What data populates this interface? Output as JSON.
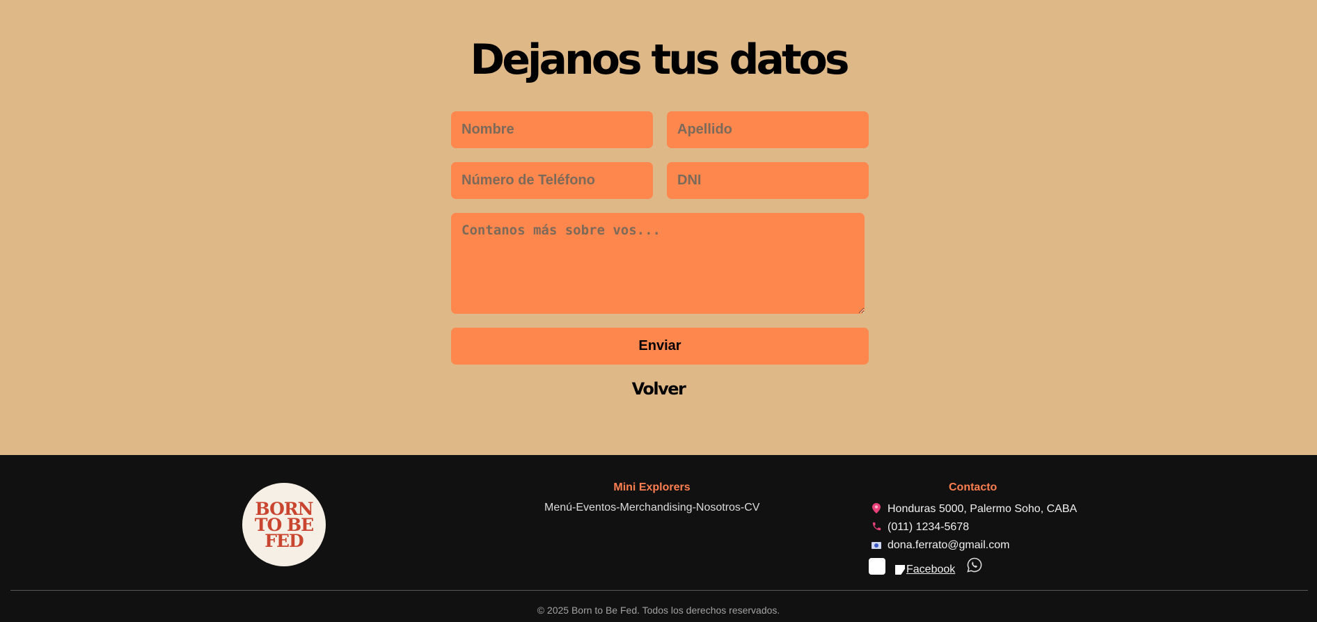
{
  "form": {
    "title": "Dejanos tus datos",
    "fields": {
      "nombre": {
        "placeholder": "Nombre",
        "value": ""
      },
      "apellido": {
        "placeholder": "Apellido",
        "value": ""
      },
      "telefono": {
        "placeholder": "Número de Teléfono",
        "value": ""
      },
      "dni": {
        "placeholder": "DNI",
        "value": ""
      },
      "mensaje": {
        "placeholder": "Contanos más sobre vos...",
        "value": ""
      }
    },
    "submit_label": "Enviar",
    "back_label": "Volver"
  },
  "footer": {
    "logo": {
      "lines": [
        "BORN",
        "TO BE",
        "FED"
      ],
      "color": "#c9452f"
    },
    "brand": {
      "title": "Mini Explorers",
      "nav": [
        "Menú",
        "Eventos",
        "Merchandising",
        "Nosotros",
        "CV"
      ],
      "separator": "-"
    },
    "contact": {
      "title": "Contacto",
      "address": "Honduras 5000, Palermo Soho, CABA",
      "phone": "(011) 1234-5678",
      "email": "dona.ferrato@gmail.com",
      "social": {
        "facebook_label": "Facebook",
        "icons": [
          "instagram-icon",
          "facebook-icon",
          "whatsapp-icon"
        ]
      }
    },
    "copyright": "© 2025 Born to Be Fed. Todos los derechos reservados."
  },
  "colors": {
    "background": "#dfb887",
    "accent": "#fe874e",
    "footer_bg": "#111111",
    "footer_title": "#ff7f50"
  }
}
